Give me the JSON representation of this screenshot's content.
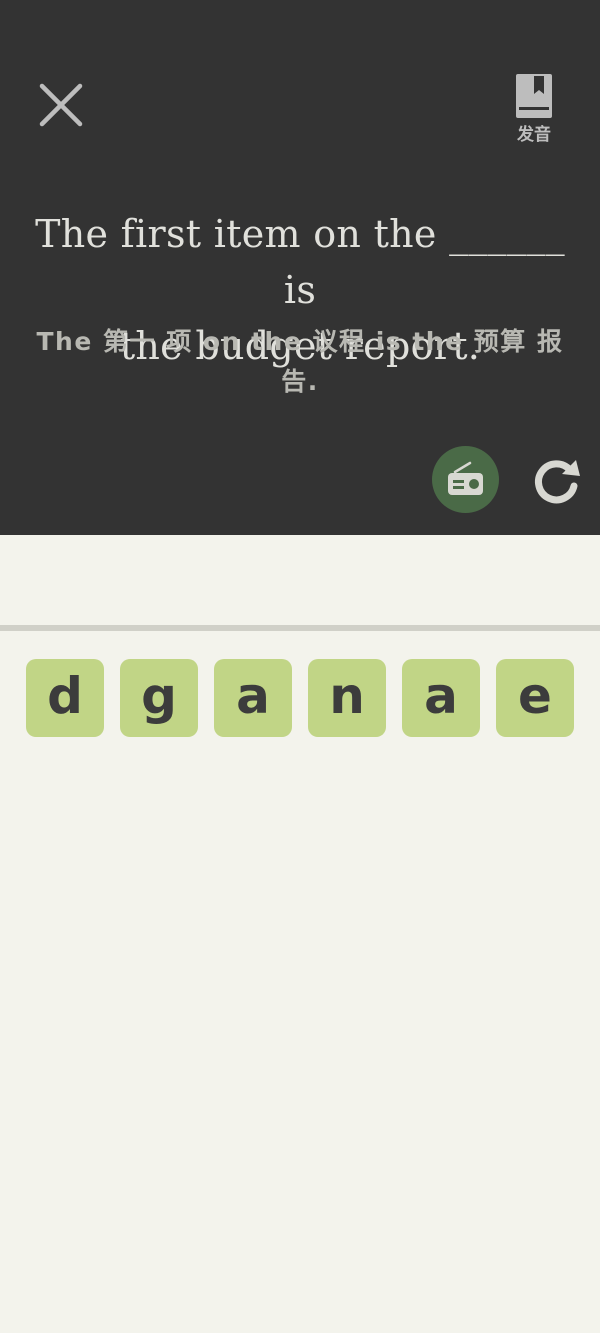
{
  "header": {
    "close_icon": "close-icon",
    "pronunciation": {
      "icon": "bookmark-book-icon",
      "label": "发音"
    }
  },
  "question": {
    "sentence_line1": "The first item on the ______ is",
    "sentence_line2": "the budget report.",
    "translation_line1": "The 第一 项 on the 议程 is the 预算 报",
    "translation_line2": "告."
  },
  "controls": {
    "radio_icon": "radio-icon",
    "refresh_icon": "refresh-icon",
    "radio_button_color": "#4a6a47"
  },
  "letters": [
    "d",
    "g",
    "a",
    "n",
    "a",
    "e"
  ],
  "colors": {
    "panel_bg": "#333333",
    "body_bg": "#f3f3ec",
    "tile_bg": "#c1d586",
    "tile_text": "#3c3c3c"
  }
}
